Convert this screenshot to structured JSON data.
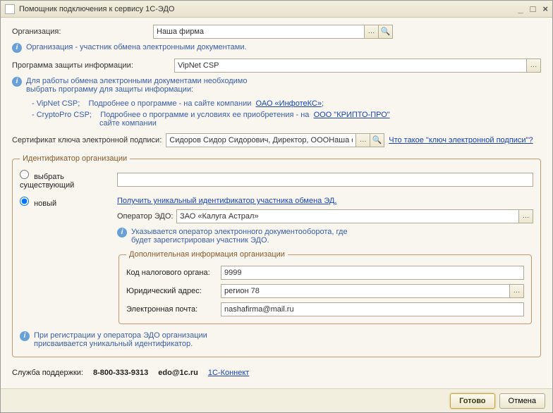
{
  "window": {
    "title": "Помощник подключения к сервису 1С-ЭДО"
  },
  "org": {
    "label": "Организация:",
    "value": "Наша фирма",
    "hint": "Организация - участник обмена электронными документами."
  },
  "crypto": {
    "label": "Программа защиты информации:",
    "value": "VipNet CSP",
    "hint1": "Для работы обмена электронными документами необходимо",
    "hint2": "выбрать программу для защиты информации:",
    "line1_prefix": "- VipNet CSP;",
    "line1_text": "Подробнее о программе - на сайте компании",
    "line1_link": "ОАО «ИнфотеКС»",
    "line2_prefix": "- CryptoPro CSP;",
    "line2_text": "Подробнее о программе и условиях ее приобретения - на",
    "line2_link": "ООО \"КРИПТО-ПРО\"",
    "line2_tail": "сайте компании"
  },
  "cert": {
    "label": "Сертификат ключа электронной подписи:",
    "value": "Сидоров Сидор Сидорович, Директор, ОООНаша фирм",
    "help_link": "Что такое \"ключ электронной подписи\"?"
  },
  "id_group": {
    "legend": "Идентификатор организации",
    "radio_existing": "выбрать существующий",
    "radio_new": "новый",
    "get_id_link": "Получить уникальный идентификатор участника обмена ЭД.",
    "operator_label": "Оператор ЭДО:",
    "operator_value": "ЗАО «Калуга Астрал»",
    "op_hint1": "Указывается оператор электронного документооборота, где",
    "op_hint2": "будет зарегистрирован участник ЭДО.",
    "inner_legend": "Дополнительная информация организации",
    "tax_label": "Код налогового органа:",
    "tax_value": "9999",
    "addr_label": "Юридический адрес:",
    "addr_value": "регион 78",
    "email_label": "Электронная почта:",
    "email_value": "nashafirma@mail.ru",
    "reg_hint1": "При регистрации у оператора ЭДО организации",
    "reg_hint2": "присваивается уникальный идентификатор."
  },
  "support": {
    "label": "Служба поддержки:",
    "phone": "8-800-333-9313",
    "email": "edo@1c.ru",
    "link": "1С-Коннект"
  },
  "buttons": {
    "done": "Готово",
    "cancel": "Отмена"
  }
}
